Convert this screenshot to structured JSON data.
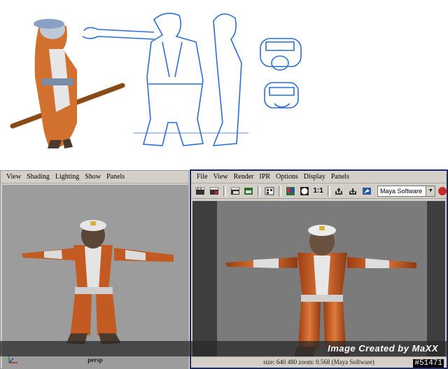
{
  "left_viewport": {
    "menu": [
      "View",
      "Shading",
      "Lighting",
      "Show",
      "Panels"
    ],
    "camera_label": "persp"
  },
  "render_view": {
    "menu": [
      "File",
      "View",
      "Render",
      "IPR",
      "Options",
      "Display",
      "Panels"
    ],
    "ratio_label": "1:1",
    "renderer": "Maya Software",
    "status": "size:  640  480 zoom: 0.568   (Maya Software)"
  },
  "credit": "Image Created by MaXX",
  "ref_number": "#51471",
  "colors": {
    "render_window_border": "#1d2a6b",
    "robe_orange": "#c9581f",
    "viewport_bg": "#9c9c9c",
    "sketch_blue": "#2a6fd6"
  }
}
